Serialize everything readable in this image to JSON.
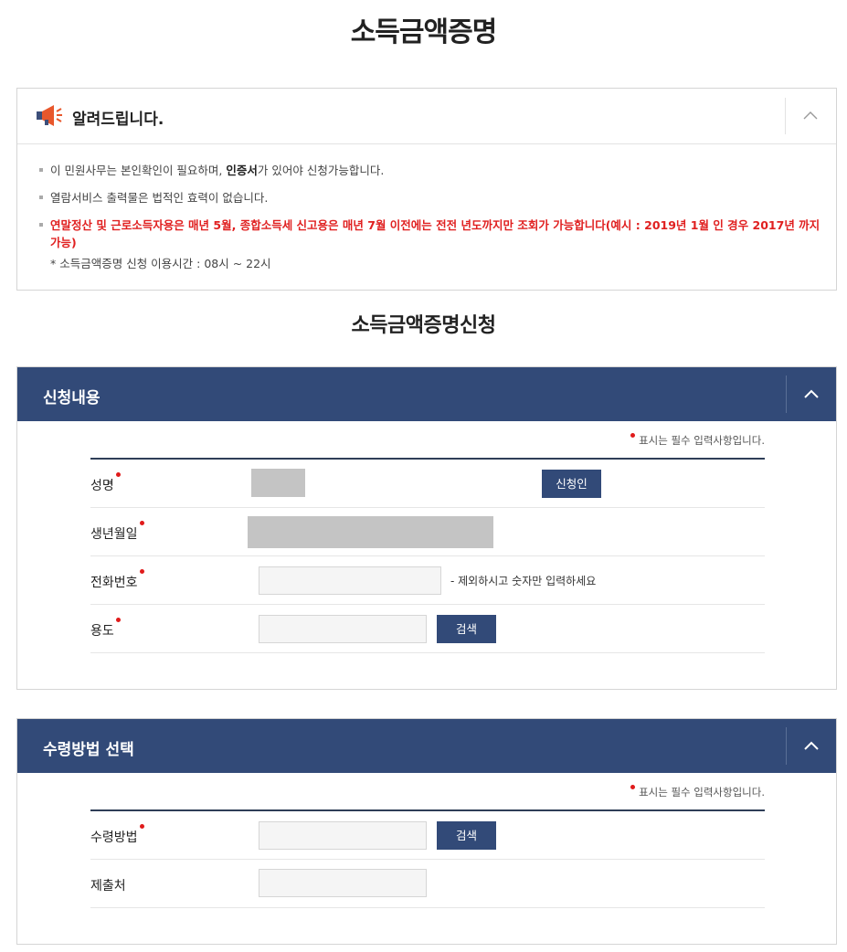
{
  "page_title": "소득금액증명",
  "notice": {
    "title": "알려드립니다.",
    "item1_pre": "이 민원사무는 본인확인이 필요하며, ",
    "item1_bold": "인증서",
    "item1_post": "가 있어야 신청가능합니다.",
    "item2": "열람서비스 출력물은 법적인 효력이 없습니다.",
    "item3": "연말정산 및 근로소득자용은 매년 5월, 종합소득세 신고용은 매년 7월 이전에는 전전 년도까지만 조회가 가능합니다(예시 : 2019년 1월 인 경우 2017년 까지 가능)",
    "sub": "* 소득금액증명 신청 이용시간 : 08시 ~ 22시"
  },
  "section_title": "소득금액증명신청",
  "panel1": {
    "title": "신청내용",
    "required_note": "표시는 필수 입력사항입니다.",
    "name_label": "성명",
    "applicant_button": "신청인",
    "birth_label": "생년월일",
    "phone_label": "전화번호",
    "phone_hint": "- 제외하시고 숫자만 입력하세요",
    "purpose_label": "용도",
    "search_button": "검색"
  },
  "panel2": {
    "title": "수령방법 선택",
    "required_note": "표시는 필수 입력사항입니다.",
    "method_label": "수령방법",
    "search_button": "검색",
    "submit_to_label": "제출처"
  },
  "colors": {
    "header_navy": "#324a78",
    "required_red": "#e01b1b",
    "warning_red": "#e02020"
  }
}
